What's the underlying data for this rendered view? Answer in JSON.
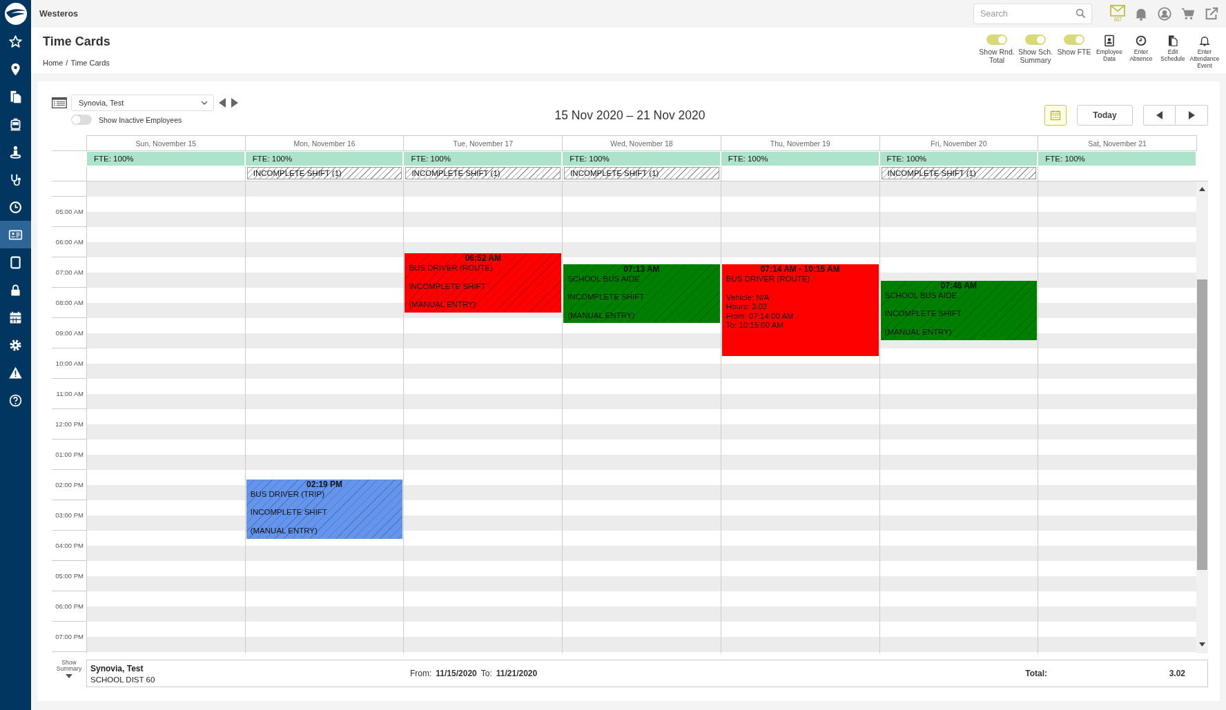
{
  "app": {
    "name": "Westeros"
  },
  "search": {
    "placeholder": "Search"
  },
  "mail": {
    "count": "167"
  },
  "sidebar": {
    "items": [
      {
        "selected": false
      },
      {
        "selected": false
      },
      {
        "selected": false
      },
      {
        "selected": false
      },
      {
        "selected": false
      },
      {
        "selected": false
      },
      {
        "selected": false
      },
      {
        "selected": true
      },
      {
        "selected": false
      },
      {
        "selected": false
      },
      {
        "selected": false
      },
      {
        "selected": false
      },
      {
        "selected": false
      },
      {
        "selected": false
      }
    ]
  },
  "page": {
    "title": "Time Cards",
    "breadcrumb": [
      "Home",
      "Time Cards"
    ],
    "breadcrumb_separator": "/"
  },
  "toggles": [
    {
      "label": "Show Rnd. Total",
      "on": true
    },
    {
      "label": "Show Sch. Summary",
      "on": true
    },
    {
      "label": "Show FTE",
      "on": true
    }
  ],
  "actions": [
    {
      "kind": "employee",
      "label": "Employee Data"
    },
    {
      "kind": "absence",
      "label": "Enter Absence"
    },
    {
      "kind": "schedule",
      "label": "Edit Schedule"
    },
    {
      "kind": "attendance",
      "label": "Enter Attendance Event"
    }
  ],
  "employee_select": {
    "value": "Synovia, Test"
  },
  "inactive_toggle": {
    "label": "Show Inactive Employees",
    "on": false
  },
  "range_title": "15 Nov 2020 – 21 Nov 2020",
  "today_button": "Today",
  "days": [
    {
      "header": "Sun, November 15",
      "fte": "FTE: 100%"
    },
    {
      "header": "Mon, November 16",
      "fte": "FTE: 100%",
      "incomplete": "INCOMPLETE SHIFT (1)",
      "events": [
        {
          "time": "02:19 PM",
          "color": "#6495ed",
          "hatched": true,
          "paragraphs": [
            [
              "BUS DRIVER (TRIP)"
            ],
            [
              "INCOMPLETE SHIFT"
            ],
            [
              "(MANUAL ENTRY)"
            ]
          ]
        }
      ]
    },
    {
      "header": "Tue, November 17",
      "fte": "FTE: 100%",
      "incomplete": "INCOMPLETE SHIFT (1)",
      "events": [
        {
          "time": "06:52 AM",
          "color": "#ff0000",
          "hatched": true,
          "paragraphs": [
            [
              "BUS DRIVER (ROUTE)"
            ],
            [
              "INCOMPLETE SHIFT"
            ],
            [
              "(MANUAL ENTRY)"
            ]
          ]
        }
      ]
    },
    {
      "header": "Wed, November 18",
      "fte": "FTE: 100%",
      "incomplete": "INCOMPLETE SHIFT (1)",
      "events": [
        {
          "time": "07:13 AM",
          "color": "#008000",
          "hatched": true,
          "paragraphs": [
            [
              "SCHOOL BUS AIDE"
            ],
            [
              "INCOMPLETE SHIFT"
            ],
            [
              "(MANUAL ENTRY)"
            ]
          ]
        }
      ]
    },
    {
      "header": "Thu, November 19",
      "fte": "FTE: 100%",
      "events": [
        {
          "time": "07:14 AM - 10:15 AM",
          "color": "#ff0000",
          "hatched": false,
          "paragraphs": [
            [
              "BUS DRIVER (ROUTE)"
            ],
            [
              "Vehicle: N/A",
              "Hours: 3.02",
              "From: 07:14:00 AM",
              "To: 10:15:00 AM"
            ]
          ]
        }
      ]
    },
    {
      "header": "Fri, November 20",
      "fte": "FTE: 100%",
      "incomplete": "INCOMPLETE SHIFT (1)",
      "events": [
        {
          "time": "07:46 AM",
          "color": "#008000",
          "hatched": true,
          "paragraphs": [
            [
              "SCHOOL BUS AIDE"
            ],
            [
              "INCOMPLETE SHIFT"
            ],
            [
              "(MANUAL ENTRY)"
            ]
          ]
        }
      ]
    },
    {
      "header": "Sat, November 21",
      "fte": "FTE: 100%"
    }
  ],
  "time_labels": [
    "05:00 AM",
    "06:00 AM",
    "07:00 AM",
    "08:00 AM",
    "09:00 AM",
    "10:00 AM",
    "11:00 AM",
    "12:00 PM",
    "01:00 PM",
    "02:00 PM",
    "03:00 PM",
    "04:00 PM",
    "05:00 PM",
    "06:00 PM",
    "07:00 PM"
  ],
  "summary": {
    "toggle_label": "Show Summary",
    "employee": "Synovia, Test",
    "district": "SCHOOL DIST 60",
    "from_label": "From:",
    "from": "11/15/2020",
    "to_label": "To:",
    "to": "11/21/2020",
    "total_label": "Total:",
    "total": "3.02"
  }
}
